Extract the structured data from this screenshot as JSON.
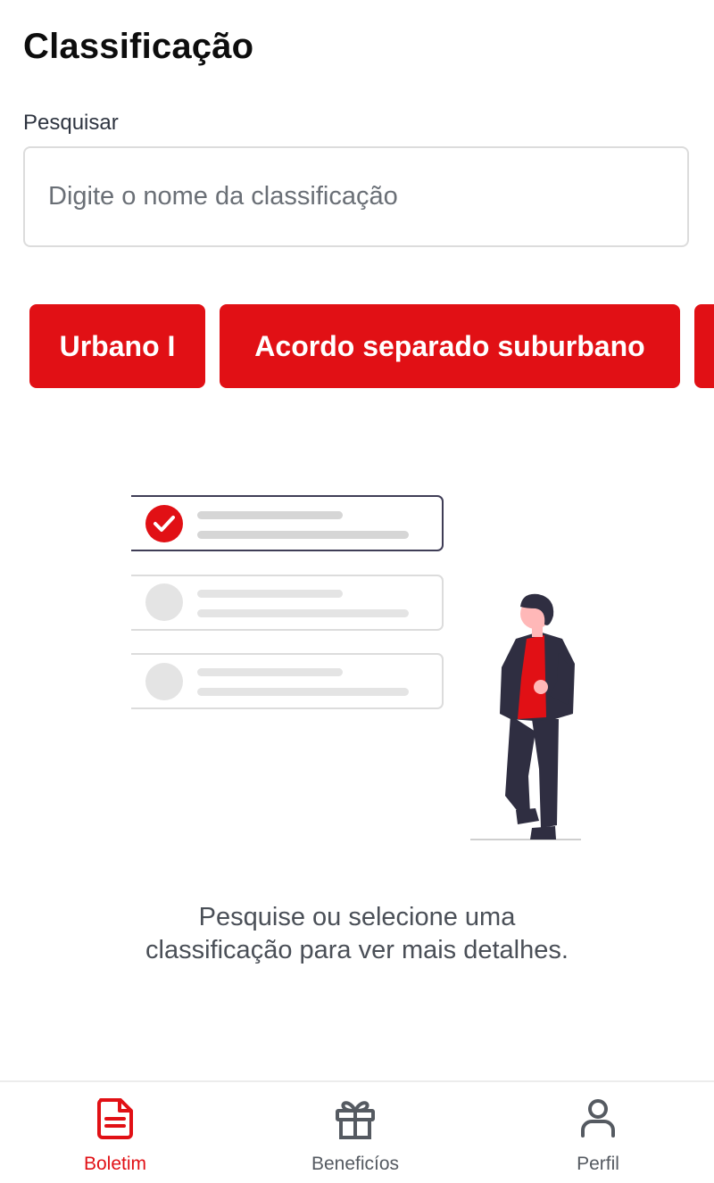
{
  "page": {
    "title": "Classificação"
  },
  "search": {
    "label": "Pesquisar",
    "placeholder": "Digite o nome da classificação",
    "value": ""
  },
  "chips": [
    {
      "label": "Urbano I"
    },
    {
      "label": "Acordo separado suburbano"
    },
    {
      "label": ""
    }
  ],
  "empty_state": {
    "message": "Pesquise ou selecione uma classificação para ver mais detalhes."
  },
  "bottom_nav": {
    "items": [
      {
        "label": "Boletim",
        "icon": "document-icon",
        "active": true
      },
      {
        "label": "Beneficíos",
        "icon": "gift-icon",
        "active": false
      },
      {
        "label": "Perfil",
        "icon": "user-icon",
        "active": false
      }
    ]
  },
  "colors": {
    "accent": "#e11015",
    "text": "#0d0d0d",
    "muted": "#4a4f57",
    "figure_dark": "#2f2e41"
  }
}
